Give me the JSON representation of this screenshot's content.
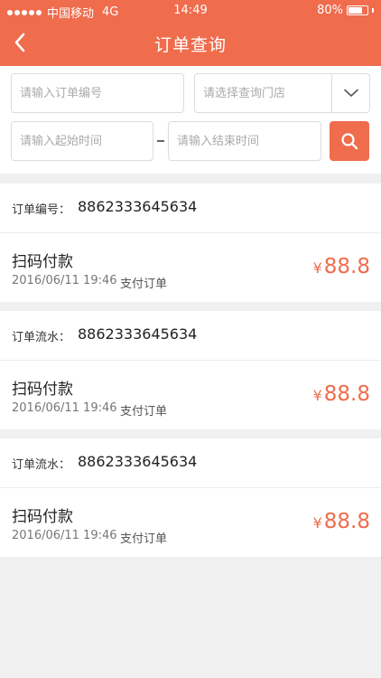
{
  "status_bar": {
    "carrier": "中国移动",
    "network": "4G",
    "time": "14:49",
    "battery": "80%",
    "battery_level": 0.8,
    "signal_bars": 5
  },
  "nav": {
    "title": "订单查询",
    "back_icon": "chevron-left-icon"
  },
  "filters": {
    "order_no_placeholder": "请输入订单编号",
    "store_placeholder": "请选择查询门店",
    "start_time_placeholder": "请输入起始时间",
    "end_time_placeholder": "请输入结束时间",
    "dropdown_icon": "chevron-down-icon",
    "search_icon": "search-icon"
  },
  "orders": [
    {
      "id_label": "订单编号：",
      "id_value": "8862333645634",
      "title": "扫码付款",
      "date": "2016/06/11 19:46",
      "status": "支付订单",
      "currency": "¥",
      "amount": "88.8"
    },
    {
      "id_label": "订单流水：",
      "id_value": "8862333645634",
      "title": "扫码付款",
      "date": "2016/06/11 19:46",
      "status": "支付订单",
      "currency": "¥",
      "amount": "88.8"
    },
    {
      "id_label": "订单流水：",
      "id_value": "8862333645634",
      "title": "扫码付款",
      "date": "2016/06/11 19:46",
      "status": "支付订单",
      "currency": "¥",
      "amount": "88.8"
    }
  ],
  "colors": {
    "accent": "#ef6c4d",
    "background": "#f0f0f0"
  }
}
